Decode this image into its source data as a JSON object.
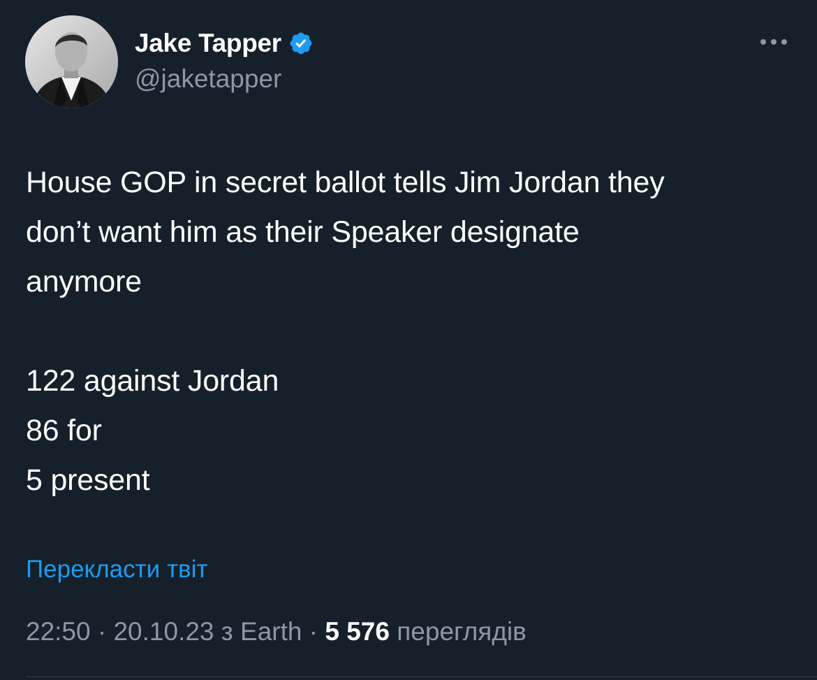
{
  "author": {
    "display_name": "Jake Tapper",
    "handle": "@jaketapper",
    "verified": true,
    "avatar_icon": "profile-photo"
  },
  "menu_icon": "more-dots-icon",
  "tweet": {
    "lines": [
      "House GOP in secret ballot tells Jim Jordan they",
      "don’t want him as their Speaker designate",
      "anymore",
      "122 against Jordan",
      "86 for",
      "5 present"
    ]
  },
  "translate_label": "Перекласти твіт",
  "meta": {
    "time": "22:50",
    "date": "20.10.23",
    "source_prefix": "з",
    "source": "Earth",
    "views_count": "5 576",
    "views_label": "переглядів",
    "separator": "·"
  },
  "colors": {
    "background": "#15202b",
    "text": "#ffffff",
    "secondary": "#8b98a5",
    "accent": "#1d9bf0"
  }
}
